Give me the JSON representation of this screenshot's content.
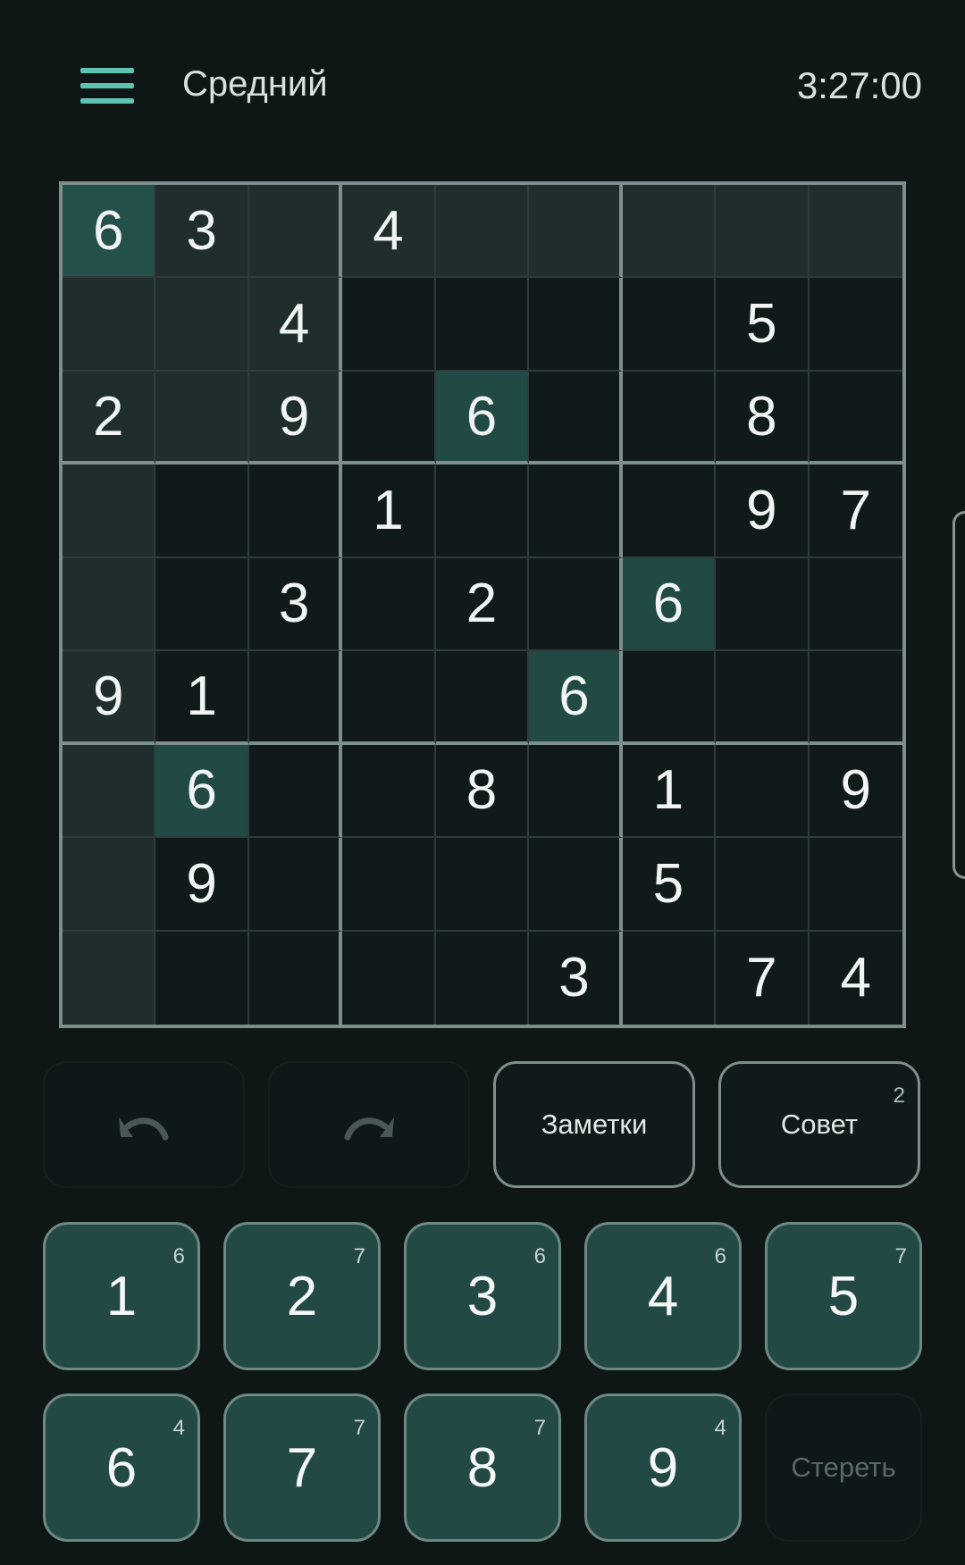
{
  "header": {
    "difficulty": "Средний",
    "timer": "3:27:00"
  },
  "board": {
    "cells": [
      [
        "6",
        "3",
        "",
        "4",
        "",
        "",
        "",
        "",
        ""
      ],
      [
        "",
        "",
        "4",
        "",
        "",
        "",
        "",
        "5",
        ""
      ],
      [
        "2",
        "",
        "9",
        "",
        "6",
        "",
        "",
        "8",
        ""
      ],
      [
        "",
        "",
        "",
        "1",
        "",
        "",
        "",
        "9",
        "7"
      ],
      [
        "",
        "",
        "3",
        "",
        "2",
        "",
        "6",
        "",
        ""
      ],
      [
        "9",
        "1",
        "",
        "",
        "",
        "6",
        "",
        "",
        ""
      ],
      [
        "",
        "6",
        "",
        "",
        "8",
        "",
        "1",
        "",
        "9"
      ],
      [
        "",
        "9",
        "",
        "",
        "",
        "",
        "5",
        "",
        ""
      ],
      [
        "",
        "",
        "",
        "",
        "",
        "3",
        "",
        "7",
        "4"
      ]
    ],
    "highlight": [
      [
        1,
        1,
        1,
        1,
        1,
        1,
        1,
        1,
        1
      ],
      [
        1,
        1,
        1,
        0,
        0,
        0,
        0,
        0,
        0
      ],
      [
        1,
        1,
        1,
        0,
        0,
        0,
        0,
        0,
        0
      ],
      [
        1,
        0,
        0,
        0,
        0,
        0,
        0,
        0,
        0
      ],
      [
        1,
        0,
        0,
        0,
        0,
        0,
        0,
        0,
        0
      ],
      [
        1,
        0,
        0,
        0,
        0,
        0,
        0,
        0,
        0
      ],
      [
        1,
        0,
        0,
        0,
        0,
        0,
        0,
        0,
        0
      ],
      [
        1,
        0,
        0,
        0,
        0,
        0,
        0,
        0,
        0
      ],
      [
        1,
        0,
        0,
        0,
        0,
        0,
        0,
        0,
        0
      ]
    ],
    "selected_value": "6"
  },
  "tools": {
    "undo_icon": "undo-icon",
    "redo_icon": "redo-icon",
    "notes_label": "Заметки",
    "hint_label": "Совет",
    "hint_count": "2"
  },
  "pad": {
    "keys": [
      {
        "digit": "1",
        "count": "6"
      },
      {
        "digit": "2",
        "count": "7"
      },
      {
        "digit": "3",
        "count": "6"
      },
      {
        "digit": "4",
        "count": "6"
      },
      {
        "digit": "5",
        "count": "7"
      },
      {
        "digit": "6",
        "count": "4"
      },
      {
        "digit": "7",
        "count": "7"
      },
      {
        "digit": "8",
        "count": "7"
      },
      {
        "digit": "9",
        "count": "4"
      }
    ],
    "erase_label": "Стереть"
  },
  "colors": {
    "accent": "#5fc3b2",
    "key_bg": "#234944",
    "selected_cell": "#24504a",
    "highlight_cell": "#1f2e2d"
  }
}
